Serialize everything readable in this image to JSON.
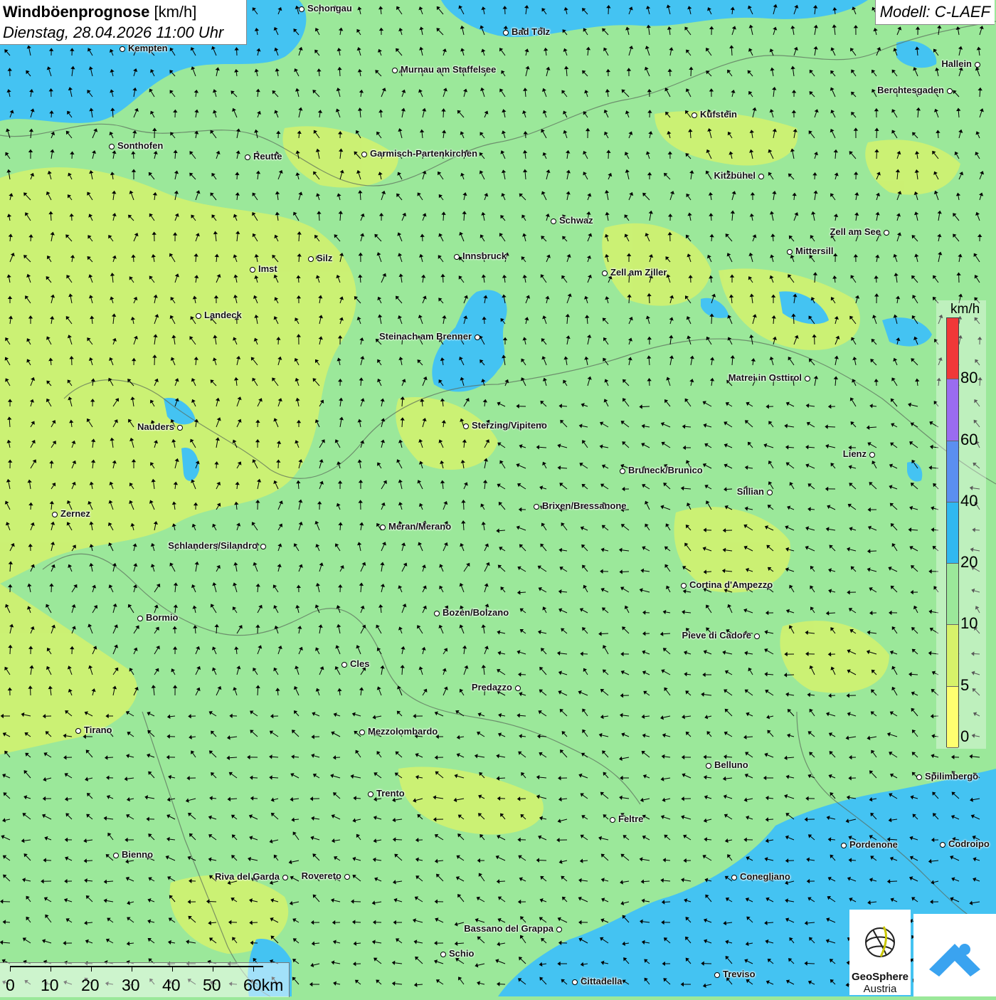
{
  "header": {
    "title": "Windböenprognose",
    "unit": "[km/h]",
    "datetime": "Dienstag, 28.04.2026 11:00 Uhr",
    "model": "Modell: C-LAEF"
  },
  "legend": {
    "unit": "km/h",
    "ticks": [
      "80",
      "60",
      "40",
      "20",
      "10",
      "5",
      "0"
    ],
    "colors": [
      "#f03838",
      "#9a6cf0",
      "#5b8ff0",
      "#30b8f0",
      "#9be89a",
      "#d7f26a",
      "#ffff70"
    ]
  },
  "scale": {
    "labels": [
      "0",
      "10",
      "20",
      "30",
      "40",
      "50",
      "60km"
    ]
  },
  "logo": {
    "geosphere_line1": "GeoSphere",
    "geosphere_line2": "Austria",
    "brand_color": "#3aa3f0"
  },
  "colors": {
    "calm_green": "#9be89a",
    "light_yellow": "#d7f26a",
    "water_blue": "#44c3f2"
  },
  "cities": [
    {
      "name": "Schongau"
    },
    {
      "name": "Bad Tölz"
    },
    {
      "name": "Kempten"
    },
    {
      "name": "Murnau am Staffelsee"
    },
    {
      "name": "Hallein"
    },
    {
      "name": "Berchtesgaden"
    },
    {
      "name": "Kufstein"
    },
    {
      "name": "Sonthofen"
    },
    {
      "name": "Reutte"
    },
    {
      "name": "Garmisch-Partenkirchen"
    },
    {
      "name": "Kitzbühel"
    },
    {
      "name": "Schwaz"
    },
    {
      "name": "Zell am See"
    },
    {
      "name": "Mittersill"
    },
    {
      "name": "Innsbruck"
    },
    {
      "name": "Silz"
    },
    {
      "name": "Imst"
    },
    {
      "name": "Zell am Ziller"
    },
    {
      "name": "Landeck"
    },
    {
      "name": "Steinach am Brenner"
    },
    {
      "name": "Matrei in Osttirol"
    },
    {
      "name": "Nauders"
    },
    {
      "name": "Sterzing/Vipiteno"
    },
    {
      "name": "Lienz"
    },
    {
      "name": "Bruneck/Brunico"
    },
    {
      "name": "Sillian"
    },
    {
      "name": "Brixen/Bressanone"
    },
    {
      "name": "Zernez"
    },
    {
      "name": "Meran/Merano"
    },
    {
      "name": "Schlanders/Silandro"
    },
    {
      "name": "Cortina d'Ampezzo"
    },
    {
      "name": "Bozen/Bolzano"
    },
    {
      "name": "Bormio"
    },
    {
      "name": "Pieve di Cadore"
    },
    {
      "name": "Cles"
    },
    {
      "name": "Predazzo"
    },
    {
      "name": "Tirano"
    },
    {
      "name": "Mezzolombardo"
    },
    {
      "name": "Belluno"
    },
    {
      "name": "Spilimbergo"
    },
    {
      "name": "Trento"
    },
    {
      "name": "Feltre"
    },
    {
      "name": "Pordenone"
    },
    {
      "name": "Codroipo"
    },
    {
      "name": "Bienno"
    },
    {
      "name": "Riva del Garda"
    },
    {
      "name": "Rovereto"
    },
    {
      "name": "Conegliano"
    },
    {
      "name": "Bassano del Grappa"
    },
    {
      "name": "Schio"
    },
    {
      "name": "Treviso"
    },
    {
      "name": "Cittadella"
    }
  ]
}
